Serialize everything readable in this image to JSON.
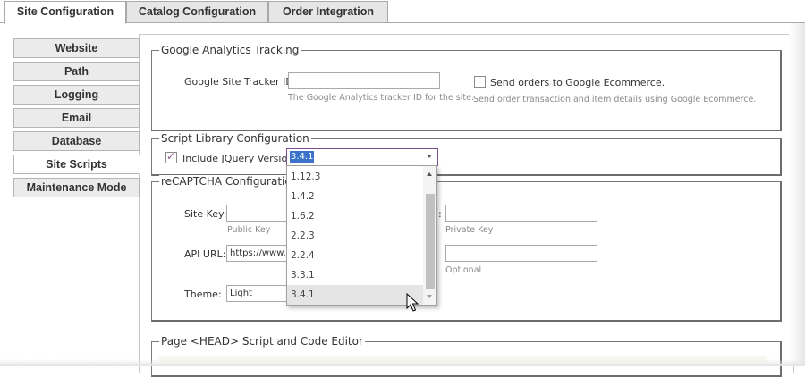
{
  "tabs": [
    {
      "label": "Site Configuration",
      "active": true
    },
    {
      "label": "Catalog Configuration",
      "active": false
    },
    {
      "label": "Order Integration",
      "active": false
    }
  ],
  "sidebar": {
    "items": [
      {
        "label": "Website"
      },
      {
        "label": "Path"
      },
      {
        "label": "Logging"
      },
      {
        "label": "Email"
      },
      {
        "label": "Database"
      },
      {
        "label": "Site Scripts",
        "active": true
      },
      {
        "label": "Maintenance Mode"
      }
    ]
  },
  "google_analytics": {
    "legend": "Google Analytics Tracking",
    "tracker_label": "Google Site Tracker ID:",
    "tracker_value": "",
    "tracker_help": "The Google Analytics tracker ID for the site.",
    "send_orders_label": "Send orders to Google Ecommerce.",
    "send_orders_checked": false,
    "send_orders_help": "Send order transaction and item details using Google Ecommerce."
  },
  "script_library": {
    "legend": "Script Library Configuration",
    "include_jquery_label": "Include JQuery Version",
    "include_jquery_checked": true,
    "jquery_version": "3.4.1",
    "jquery_options": [
      "1.12.3",
      "1.4.2",
      "1.6.2",
      "2.2.3",
      "2.2.4",
      "3.3.1",
      "3.4.1"
    ],
    "hovered_option": "3.4.1"
  },
  "recaptcha": {
    "legend": "reCAPTCHA Configuration",
    "site_key_label": "Site Key:",
    "site_key_value": "",
    "site_key_help": "Public Key",
    "secret_key_label_suffix": ":",
    "secret_key_value": "",
    "secret_key_help": "Private Key",
    "api_url_label": "API URL:",
    "api_url_value": "https://www.g",
    "optional_value": "",
    "optional_help": "Optional",
    "theme_label": "Theme:",
    "theme_value": "Light"
  },
  "head_editor": {
    "legend": "Page <HEAD> Script and Code Editor"
  },
  "colors": {
    "accent": "#7a4f8e",
    "selection": "#3a73c9",
    "check": "#8b5d8f"
  }
}
